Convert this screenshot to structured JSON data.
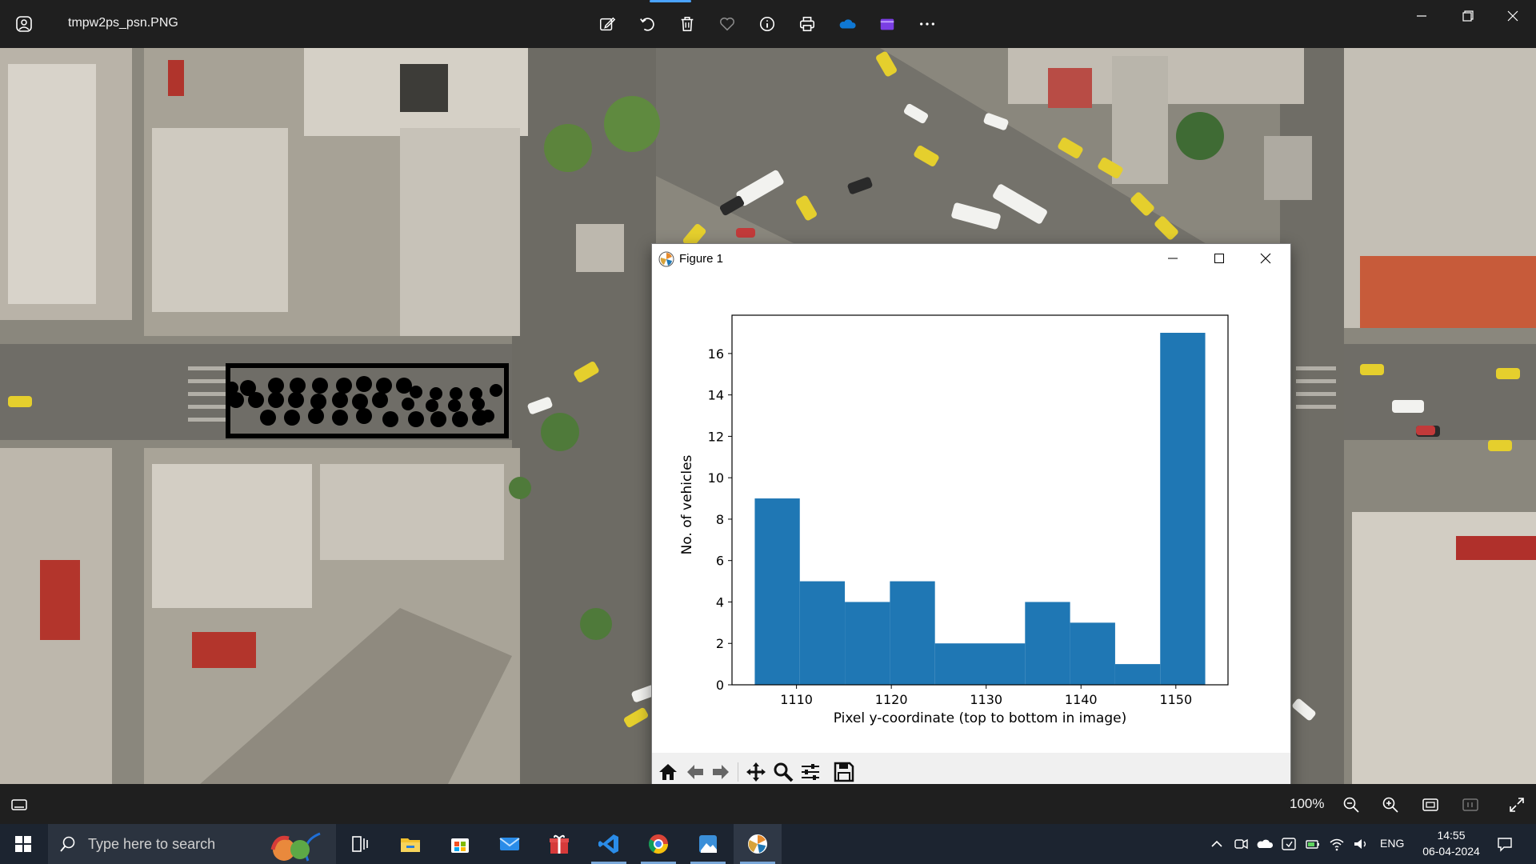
{
  "photos_app": {
    "file_name": "tmpw2ps_psn.PNG",
    "zoom_level": "100%",
    "toolbar_icons": [
      "edit-icon",
      "rotate-icon",
      "delete-icon",
      "favorite-icon",
      "info-icon",
      "print-icon",
      "onedrive-icon",
      "clipchamp-icon",
      "more-icon"
    ]
  },
  "figure_window": {
    "title": "Figure 1",
    "toolbar_icons": [
      "home-icon",
      "back-icon",
      "forward-icon",
      "pan-icon",
      "zoom-icon",
      "configure-icon",
      "save-icon"
    ]
  },
  "chart_data": {
    "type": "histogram",
    "title": "",
    "xlabel": "Pixel y-coordinate (top to bottom in image)",
    "ylabel": "No. of vehicles",
    "bin_edges": [
      1105.6,
      1110.35,
      1115.1,
      1119.85,
      1124.6,
      1129.35,
      1134.1,
      1138.85,
      1143.6,
      1148.35,
      1153.1
    ],
    "values": [
      9,
      5,
      4,
      5,
      2,
      2,
      4,
      3,
      1,
      17
    ],
    "xlim": [
      1103.2,
      1155.5
    ],
    "ylim": [
      0,
      17.85
    ],
    "x_ticks": [
      "1110",
      "1120",
      "1130",
      "1140",
      "1150"
    ],
    "y_ticks": [
      "0",
      "2",
      "4",
      "6",
      "8",
      "10",
      "12",
      "14",
      "16"
    ],
    "bar_color": "#1f77b4",
    "grid": false
  },
  "taskbar": {
    "search_placeholder": "Type here to search",
    "language": "ENG",
    "time": "14:55",
    "date": "06-04-2024"
  }
}
